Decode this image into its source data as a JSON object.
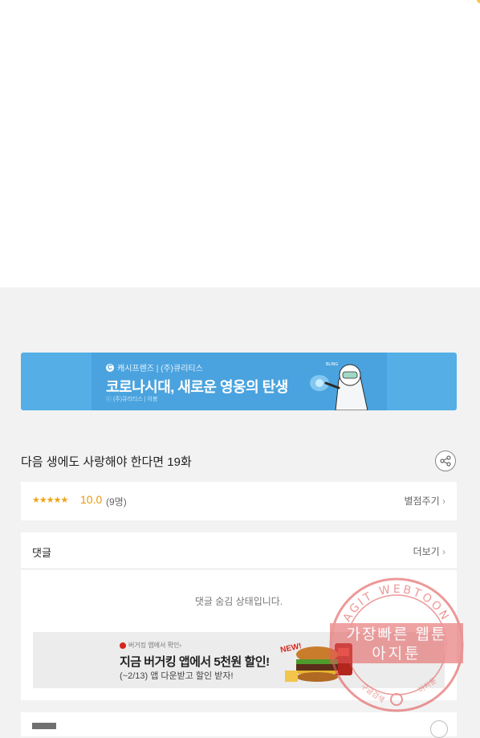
{
  "banner": {
    "brand": "캐시프렌즈 | (주)큐리티스",
    "headline": "코로나시대, 새로운 영웅의 탄생",
    "sub": "ⓒ (주)큐리티스  |  이봉"
  },
  "episode": {
    "title": "다음 생에도 사랑해야 한다면 19화"
  },
  "rating": {
    "stars": "★★★★★",
    "score": "10.0",
    "count": "(9명)",
    "rate_link": "별점주기"
  },
  "comments": {
    "title": "댓글",
    "more": "더보기",
    "hidden_message": "댓글 숨김 상태입니다."
  },
  "ad": {
    "small": "버거킹 앱에서 확인›",
    "main": "지금 버거킹 앱에서 5천원 할인!",
    "sub": "(~2/13) 앱 다운받고 할인 받자!",
    "badge": "NEW!"
  },
  "watermark": {
    "ring_text": "AGIT WEBTOON",
    "line1": "가장빠른 웹툰",
    "line2": "아지툰",
    "bottom_left": "구글검색",
    "bottom_right": "아지툰"
  },
  "colors": {
    "banner_bg": "#55aee6",
    "star": "#f1a217",
    "watermark": "#e35a5a"
  }
}
